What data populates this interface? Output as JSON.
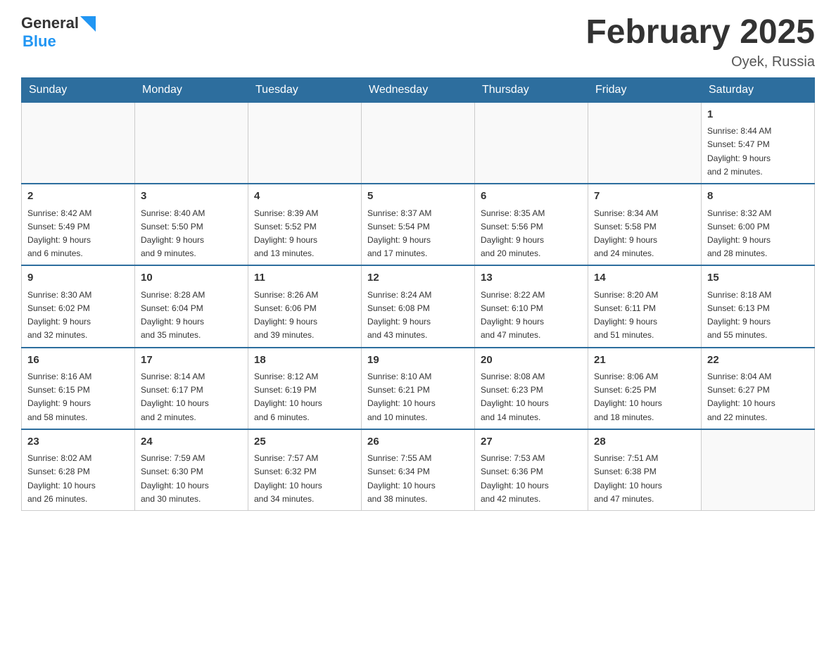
{
  "header": {
    "logo_general": "General",
    "logo_blue": "Blue",
    "title": "February 2025",
    "subtitle": "Oyek, Russia"
  },
  "weekdays": [
    "Sunday",
    "Monday",
    "Tuesday",
    "Wednesday",
    "Thursday",
    "Friday",
    "Saturday"
  ],
  "weeks": [
    [
      {
        "day": "",
        "info": ""
      },
      {
        "day": "",
        "info": ""
      },
      {
        "day": "",
        "info": ""
      },
      {
        "day": "",
        "info": ""
      },
      {
        "day": "",
        "info": ""
      },
      {
        "day": "",
        "info": ""
      },
      {
        "day": "1",
        "info": "Sunrise: 8:44 AM\nSunset: 5:47 PM\nDaylight: 9 hours\nand 2 minutes."
      }
    ],
    [
      {
        "day": "2",
        "info": "Sunrise: 8:42 AM\nSunset: 5:49 PM\nDaylight: 9 hours\nand 6 minutes."
      },
      {
        "day": "3",
        "info": "Sunrise: 8:40 AM\nSunset: 5:50 PM\nDaylight: 9 hours\nand 9 minutes."
      },
      {
        "day": "4",
        "info": "Sunrise: 8:39 AM\nSunset: 5:52 PM\nDaylight: 9 hours\nand 13 minutes."
      },
      {
        "day": "5",
        "info": "Sunrise: 8:37 AM\nSunset: 5:54 PM\nDaylight: 9 hours\nand 17 minutes."
      },
      {
        "day": "6",
        "info": "Sunrise: 8:35 AM\nSunset: 5:56 PM\nDaylight: 9 hours\nand 20 minutes."
      },
      {
        "day": "7",
        "info": "Sunrise: 8:34 AM\nSunset: 5:58 PM\nDaylight: 9 hours\nand 24 minutes."
      },
      {
        "day": "8",
        "info": "Sunrise: 8:32 AM\nSunset: 6:00 PM\nDaylight: 9 hours\nand 28 minutes."
      }
    ],
    [
      {
        "day": "9",
        "info": "Sunrise: 8:30 AM\nSunset: 6:02 PM\nDaylight: 9 hours\nand 32 minutes."
      },
      {
        "day": "10",
        "info": "Sunrise: 8:28 AM\nSunset: 6:04 PM\nDaylight: 9 hours\nand 35 minutes."
      },
      {
        "day": "11",
        "info": "Sunrise: 8:26 AM\nSunset: 6:06 PM\nDaylight: 9 hours\nand 39 minutes."
      },
      {
        "day": "12",
        "info": "Sunrise: 8:24 AM\nSunset: 6:08 PM\nDaylight: 9 hours\nand 43 minutes."
      },
      {
        "day": "13",
        "info": "Sunrise: 8:22 AM\nSunset: 6:10 PM\nDaylight: 9 hours\nand 47 minutes."
      },
      {
        "day": "14",
        "info": "Sunrise: 8:20 AM\nSunset: 6:11 PM\nDaylight: 9 hours\nand 51 minutes."
      },
      {
        "day": "15",
        "info": "Sunrise: 8:18 AM\nSunset: 6:13 PM\nDaylight: 9 hours\nand 55 minutes."
      }
    ],
    [
      {
        "day": "16",
        "info": "Sunrise: 8:16 AM\nSunset: 6:15 PM\nDaylight: 9 hours\nand 58 minutes."
      },
      {
        "day": "17",
        "info": "Sunrise: 8:14 AM\nSunset: 6:17 PM\nDaylight: 10 hours\nand 2 minutes."
      },
      {
        "day": "18",
        "info": "Sunrise: 8:12 AM\nSunset: 6:19 PM\nDaylight: 10 hours\nand 6 minutes."
      },
      {
        "day": "19",
        "info": "Sunrise: 8:10 AM\nSunset: 6:21 PM\nDaylight: 10 hours\nand 10 minutes."
      },
      {
        "day": "20",
        "info": "Sunrise: 8:08 AM\nSunset: 6:23 PM\nDaylight: 10 hours\nand 14 minutes."
      },
      {
        "day": "21",
        "info": "Sunrise: 8:06 AM\nSunset: 6:25 PM\nDaylight: 10 hours\nand 18 minutes."
      },
      {
        "day": "22",
        "info": "Sunrise: 8:04 AM\nSunset: 6:27 PM\nDaylight: 10 hours\nand 22 minutes."
      }
    ],
    [
      {
        "day": "23",
        "info": "Sunrise: 8:02 AM\nSunset: 6:28 PM\nDaylight: 10 hours\nand 26 minutes."
      },
      {
        "day": "24",
        "info": "Sunrise: 7:59 AM\nSunset: 6:30 PM\nDaylight: 10 hours\nand 30 minutes."
      },
      {
        "day": "25",
        "info": "Sunrise: 7:57 AM\nSunset: 6:32 PM\nDaylight: 10 hours\nand 34 minutes."
      },
      {
        "day": "26",
        "info": "Sunrise: 7:55 AM\nSunset: 6:34 PM\nDaylight: 10 hours\nand 38 minutes."
      },
      {
        "day": "27",
        "info": "Sunrise: 7:53 AM\nSunset: 6:36 PM\nDaylight: 10 hours\nand 42 minutes."
      },
      {
        "day": "28",
        "info": "Sunrise: 7:51 AM\nSunset: 6:38 PM\nDaylight: 10 hours\nand 47 minutes."
      },
      {
        "day": "",
        "info": ""
      }
    ]
  ]
}
